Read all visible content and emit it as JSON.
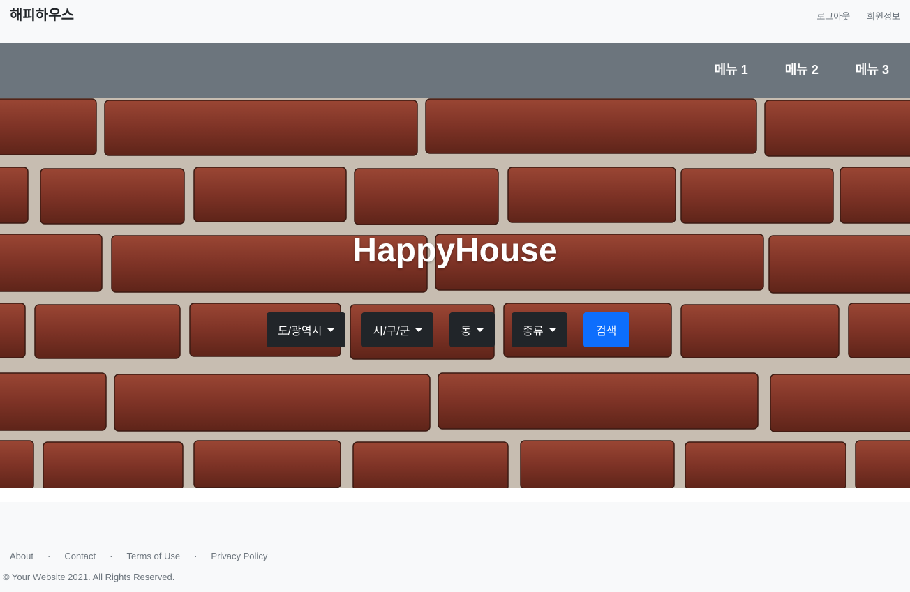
{
  "header": {
    "brand": "해피하우스",
    "links": [
      "로그아웃",
      "회원정보"
    ]
  },
  "menu": {
    "items": [
      "메뉴 1",
      "메뉴 2",
      "메뉴 3"
    ]
  },
  "hero": {
    "title": "HappyHouse",
    "dropdowns": [
      "도/광역시",
      "시/구/군",
      "동",
      "종류"
    ],
    "search_label": "검색"
  },
  "footer": {
    "links": [
      "About",
      "Contact",
      "Terms of Use",
      "Privacy Policy"
    ],
    "copyright": "© Your Website 2021. All Rights Reserved."
  },
  "colors": {
    "menubar": "#6c757d",
    "dropdown": "#212529",
    "primary": "#0d6efd",
    "brick": "#8a3a2a",
    "mortar": "#c9bfb3"
  }
}
